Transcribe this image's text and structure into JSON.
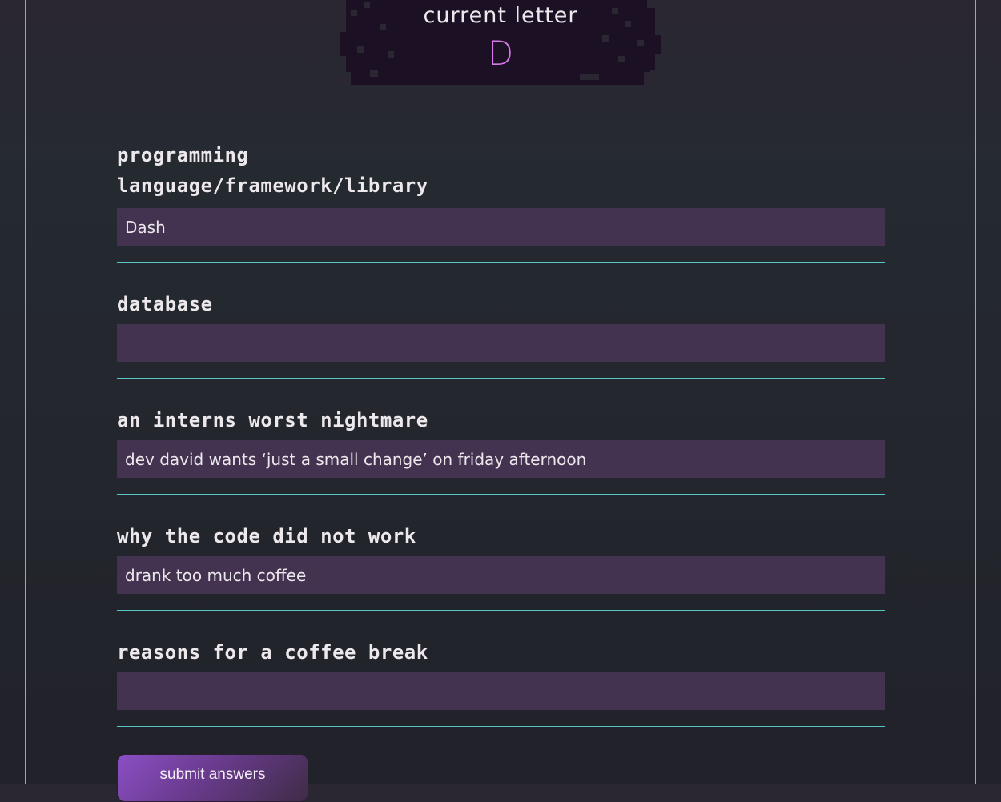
{
  "header": {
    "title": "current letter",
    "letter": "D"
  },
  "form": {
    "fields": [
      {
        "label": "programming language/framework/library",
        "value": "Dash",
        "placeholder": ""
      },
      {
        "label": "database",
        "value": "",
        "placeholder": ""
      },
      {
        "label": "an interns worst nightmare",
        "value": "dev david wants ‘just a small change’ on friday afternoon",
        "placeholder": ""
      },
      {
        "label": "why the code did not work",
        "value": "drank too much coffee",
        "placeholder": ""
      },
      {
        "label": "reasons for a coffee break",
        "value": "",
        "placeholder": ""
      }
    ],
    "submit_label": "submit answers"
  },
  "colors": {
    "accent_line": "#58c6c4",
    "letter_color": "#d978ea",
    "input_background": "#433350",
    "letter_box_background": "#1c1024"
  }
}
